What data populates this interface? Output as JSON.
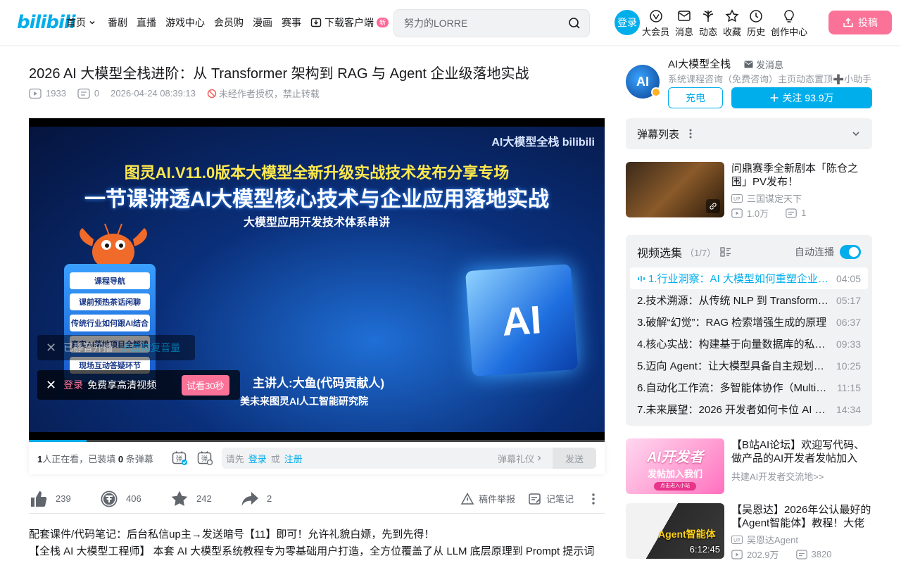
{
  "header": {
    "logo": "bilibili",
    "nav": [
      {
        "label": "首页",
        "has_chevron": true
      },
      {
        "label": "番剧"
      },
      {
        "label": "直播"
      },
      {
        "label": "游戏中心"
      },
      {
        "label": "会员购"
      },
      {
        "label": "漫画"
      },
      {
        "label": "赛事"
      },
      {
        "label": "下载客户端",
        "badge": "新"
      }
    ],
    "search_placeholder": "努力的LORRE",
    "login": "登录",
    "entries": [
      "大会员",
      "消息",
      "动态",
      "收藏",
      "历史",
      "创作中心"
    ],
    "upload": "投稿"
  },
  "video": {
    "title": "2026 AI 大模型全栈进阶：从 Transformer 架构到 RAG 与 Agent 企业级落地实战",
    "views": "1933",
    "danmaku_count": "0",
    "date": "2026-04-24 08:39:13",
    "copyright": "未经作者授权，禁止转载"
  },
  "player": {
    "watermark": "AI大模型全栈 bilibili",
    "poster_line1": "图灵AI.V11.0版本大模型全新升级实战技术发布分享专场",
    "poster_line2": "一节课讲透AI大模型核心技术与企业应用落地实战",
    "poster_line3": "大模型应用开发技术体系串讲",
    "poster_menu": [
      "课程导航",
      "课前预热茶话闲聊",
      "传统行业如何跟AI结合",
      "真实AI落地项目全解读",
      "现场互动答疑环节"
    ],
    "speaker": "主讲人:大鱼(代码贡献人)",
    "speaker_org": "美未来图灵AI人工智能研究院",
    "cube_text": "AI",
    "mute_tip": "已静音开播",
    "mute_action": "点击恢复音量",
    "login_tip_link": "登录",
    "login_tip_text": "免费享高清视频",
    "try_btn": "试看30秒",
    "progress": 0.1
  },
  "sending_bar": {
    "viewers_count": "1",
    "viewers_text": "人正在看，已装填",
    "loaded_count": "0",
    "loaded_text": "条弹幕",
    "input_prefix": "请先",
    "login_link": "登录",
    "or": "或",
    "register_link": "注册",
    "etiquette": "弹幕礼仪",
    "send": "发送"
  },
  "toolbar": {
    "like": "239",
    "coin": "406",
    "fav": "242",
    "share": "2",
    "report": "稿件举报",
    "note": "记笔记"
  },
  "description": [
    "配套课件/代码笔记：后台私信up主→发送暗号【11】即可！允许礼貌白嫖，先到先得！",
    "【全栈 AI 大模型工程师】 本套 AI 大模型系统教程专为零基础用户打造，全方位覆盖了从 LLM 底层原理到 Prompt 提示词"
  ],
  "up": {
    "avatar_text": "AI",
    "name": "AI大模型全栈",
    "send_msg": "发消息",
    "desc": "系统课程咨询（免费咨询）主页动态置顶➕小助手",
    "charge": "充电",
    "follow": "关注 93.9万"
  },
  "danmaku_list": {
    "label": "弹幕列表"
  },
  "recommend_top": {
    "title": "问鼎赛季全新剧本「陈仓之围」PV发布！",
    "author": "三国谋定天下",
    "views": "1.0万",
    "comments": "1"
  },
  "playlist": {
    "title": "视频选集",
    "count": "（1/7）",
    "autoplay": "自动连播",
    "items": [
      {
        "name": "1.行业洞察：AI 大模型如何重塑企业级应用",
        "duration": "04:05",
        "active": true
      },
      {
        "name": "2.技术溯源：从传统 NLP 到 Transformer 架构",
        "duration": "05:17"
      },
      {
        "name": "3.破解“幻觉”：RAG 检索增强生成的原理",
        "duration": "06:37"
      },
      {
        "name": "4.核心实战：构建基于向量数据库的私有知识库",
        "duration": "09:33"
      },
      {
        "name": "5.迈向 Agent：让大模型具备自主规划能力",
        "duration": "10:25"
      },
      {
        "name": "6.自动化工作流：多智能体协作（Multi-Agent）",
        "duration": "11:15"
      },
      {
        "name": "7.未来展望：2026 开发者如何卡位 AI 时代",
        "duration": "14:34"
      }
    ]
  },
  "recommend": [
    {
      "thumb_line1": "AI开发者",
      "thumb_line2": "发帖加入我们",
      "thumb_btn": "点击进入小站",
      "title": "【B站AI论坛】欢迎写代码、做产品的AI开发者发帖加入",
      "sub": "共建AI开发者交流地>>"
    },
    {
      "thumb_text": "Agent智能体",
      "duration": "6:12:45",
      "title": "【吴恩达】2026年公认最好的【Agent智能体】教程！大佬带你",
      "author": "吴恩达Agent",
      "views": "202.9万",
      "comments": "3820"
    }
  ]
}
